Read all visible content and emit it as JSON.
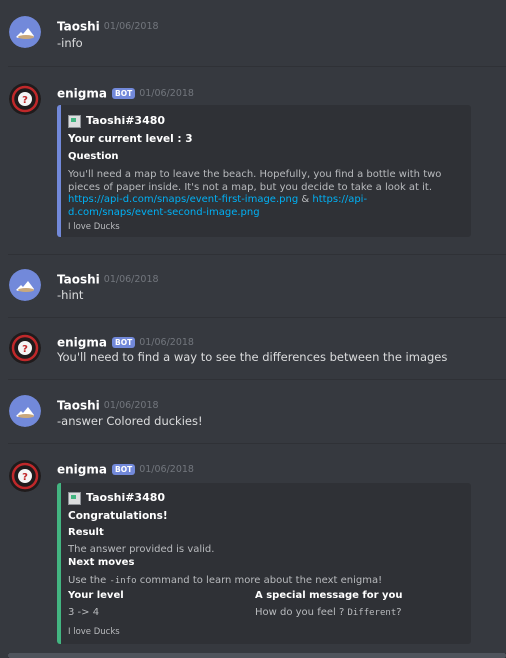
{
  "users": {
    "taoshi": {
      "name": "Taoshi"
    },
    "enigma": {
      "name": "enigma",
      "badge": "BOT"
    }
  },
  "messages": [
    {
      "author": "Taoshi",
      "timestamp": "01/06/2018",
      "text": "-info"
    },
    {
      "author": "enigma",
      "timestamp": "01/06/2018",
      "embed": {
        "author": "Taoshi#3480",
        "title": "Your current level : 3",
        "field_name": "Question",
        "desc_part1": "You'll need a map to leave the beach. Hopefully, you find a bottle with two pieces of paper inside. It's not a map, but you decide to take a look at it.",
        "link1": "https://api-d.com/snaps/event-first-image.png",
        "amp": "&",
        "link2": "https://api-d.com/snaps/event-second-image.png",
        "footer": "I love Ducks",
        "color": "#7289da"
      }
    },
    {
      "author": "Taoshi",
      "timestamp": "01/06/2018",
      "text": "-hint"
    },
    {
      "author": "enigma",
      "timestamp": "01/06/2018",
      "text": "You'll need to find a way to see the differences between the images"
    },
    {
      "author": "Taoshi",
      "timestamp": "01/06/2018",
      "text": "-answer Colored duckies!"
    },
    {
      "author": "enigma",
      "timestamp": "01/06/2018",
      "embed": {
        "author": "Taoshi#3480",
        "title": "Congratulations!",
        "result_name": "Result",
        "result_value": "The answer provided is valid.",
        "next_name": "Next moves",
        "next_pre": "Use the ",
        "next_code": "-info",
        "next_post": " command to learn more about the next enigma!",
        "level_name": "Your level",
        "level_value": "3 -> 4",
        "special_name": "A special message for you",
        "special_pre": "How do you feel ? ",
        "special_code": "Different",
        "special_post": "?",
        "footer": "I love Ducks",
        "color": "#43b581"
      }
    }
  ],
  "colors": {
    "background": "#36393f",
    "embed_bg": "#2f3136",
    "link": "#00b0f4",
    "bot_badge": "#7289da"
  }
}
